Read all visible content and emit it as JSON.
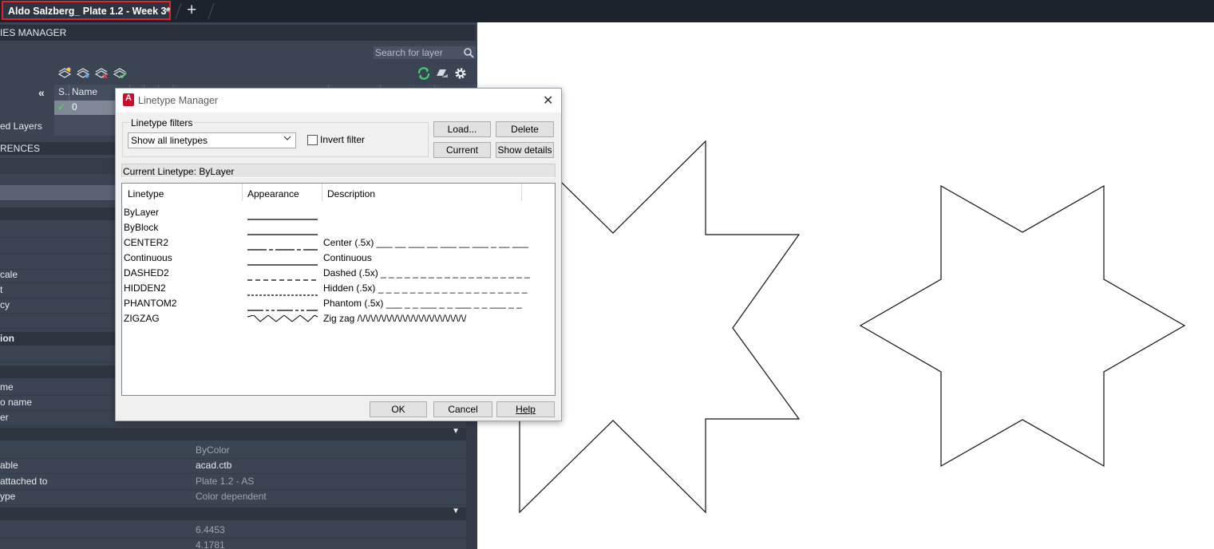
{
  "tabbar": {
    "doc_tab_title": "Aldo Salzberg_ Plate 1.2 - Week 3*",
    "close_glyph": "×",
    "new_tab_glyph": "+"
  },
  "palette": {
    "title": "IES MANAGER",
    "search_placeholder": "Search for layer",
    "collapse_glyph": "«",
    "tree_item": "ed Layers",
    "columns": {
      "status": "S..",
      "name": "Name"
    },
    "layer_row": {
      "check": "✓",
      "name": "0"
    },
    "section_xrefs": "RENCES",
    "rows": [
      {
        "label": "cale",
        "value": ""
      },
      {
        "label": "t",
        "value": ""
      },
      {
        "label": "cy",
        "value": ""
      }
    ],
    "section_location": "ion",
    "name_rows": [
      {
        "label": "me",
        "value": ""
      },
      {
        "label": "o name",
        "value": ""
      },
      {
        "label": "er",
        "value": ""
      }
    ],
    "plot_rows": [
      {
        "label": "",
        "value": "ByColor",
        "bright": false
      },
      {
        "label": "able",
        "value": "acad.ctb",
        "bright": true
      },
      {
        "label": "attached to",
        "value": "Plate 1.2 - AS",
        "bright": false
      },
      {
        "label": "ype",
        "value": "Color dependent",
        "bright": false
      }
    ],
    "num_rows": [
      {
        "label": "",
        "value": "6.4453"
      },
      {
        "label": "",
        "value": "4.1781"
      }
    ]
  },
  "dialog": {
    "title": "Linetype Manager",
    "app_icon_letter": "A",
    "close_glyph": "✕",
    "filters_legend": "Linetype filters",
    "filter_value": "Show all linetypes",
    "invert_label": "Invert filter",
    "buttons": {
      "load": "Load...",
      "delete": "Delete",
      "current": "Current",
      "show_details": "Show details",
      "ok": "OK",
      "cancel": "Cancel",
      "help": "Help"
    },
    "current_linetype": "Current Linetype:  ByLayer",
    "headers": {
      "linetype": "Linetype",
      "appearance": "Appearance",
      "description": "Description"
    },
    "linetypes": [
      {
        "name": "ByLayer",
        "appearance": "solid",
        "description": ""
      },
      {
        "name": "ByBlock",
        "appearance": "solid",
        "description": ""
      },
      {
        "name": "CENTER2",
        "appearance": "center",
        "description": "Center (.5x) ___ __ ___ __ ___ __ ___ _ __ ___"
      },
      {
        "name": "Continuous",
        "appearance": "solid",
        "description": "Continuous"
      },
      {
        "name": "DASHED2",
        "appearance": "dashed",
        "description": "Dashed (.5x) _ _ _ _ _ _ _ _ _ _ _ _ _ _ _ _ _ _ _"
      },
      {
        "name": "HIDDEN2",
        "appearance": "hidden",
        "description": "Hidden (.5x) _ _ _ _ _ _ _ _ _ _ _ _ _ _ _ _ _ _ _"
      },
      {
        "name": "PHANTOM2",
        "appearance": "phantom",
        "description": "Phantom (.5x) ___ _ _ ___ _ _ ___ _ _ ___ _ _"
      },
      {
        "name": "ZIGZAG",
        "appearance": "zigzag",
        "description": "Zig zag /\\/\\/\\/\\/\\/\\/\\/\\/\\/\\/\\/\\/\\/\\/\\/\\/\\/\\/\\/\\/"
      }
    ]
  },
  "colors": {
    "tab_highlight": "#e0202a",
    "palette_bg": "#3b4453",
    "refresh_green": "#3ecf6b"
  }
}
